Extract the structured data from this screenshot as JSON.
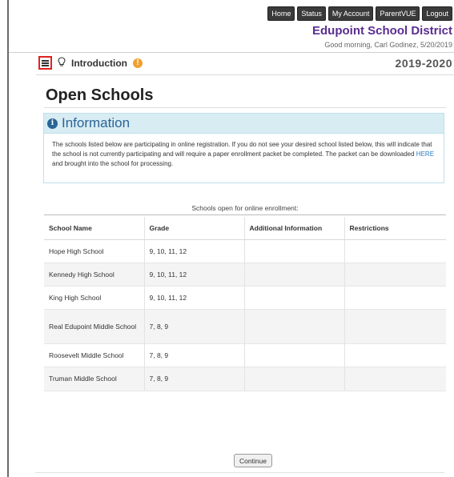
{
  "topnav": {
    "buttons": [
      "Home",
      "Status",
      "My Account",
      "ParentVUE",
      "Logout"
    ]
  },
  "header": {
    "district": "Edupoint School District",
    "greeting": "Good morning, Carl Godinez, 5/20/2019"
  },
  "intro": {
    "title": "Introduction",
    "warning": "!",
    "school_year": "2019-2020",
    "icons": [
      "menu-icon",
      "lightbulb-icon",
      "warning-icon"
    ]
  },
  "main": {
    "heading": "Open Schools"
  },
  "info": {
    "icon": "i",
    "title": "Information",
    "text_before_link": "The schools listed below are participating in online registration. If you do not see your desired school listed below, this will indicate that the school is not currently participating and will require a paper enrollment packet be completed. The packet can be downloaded ",
    "link_text": "HERE",
    "text_after_link": " and brought into the school for processing."
  },
  "table": {
    "caption": "Schools open for online enrollment:",
    "columns": [
      "School Name",
      "Grade",
      "Additional Information",
      "Restrictions"
    ],
    "rows": [
      {
        "school": "Hope High School",
        "grade": "9, 10, 11, 12",
        "info": "",
        "restrictions": ""
      },
      {
        "school": "Kennedy High School",
        "grade": "9, 10, 11, 12",
        "info": "",
        "restrictions": ""
      },
      {
        "school": "King High School",
        "grade": "9, 10, 11, 12",
        "info": "",
        "restrictions": ""
      },
      {
        "school": "Real Edupoint Middle School",
        "grade": "7, 8, 9",
        "info": "",
        "restrictions": ""
      },
      {
        "school": "Roosevelt Middle School",
        "grade": "7, 8, 9",
        "info": "",
        "restrictions": ""
      },
      {
        "school": "Truman Middle School",
        "grade": "7, 8, 9",
        "info": "",
        "restrictions": ""
      }
    ]
  },
  "footer": {
    "continue_label": "Continue"
  },
  "colors": {
    "district": "#5a2d91",
    "info_header_bg": "#d8ecf4",
    "info_title": "#2a6496",
    "menu_highlight": "#e0231e",
    "warning": "#f0a030",
    "link": "#2a7abf"
  }
}
